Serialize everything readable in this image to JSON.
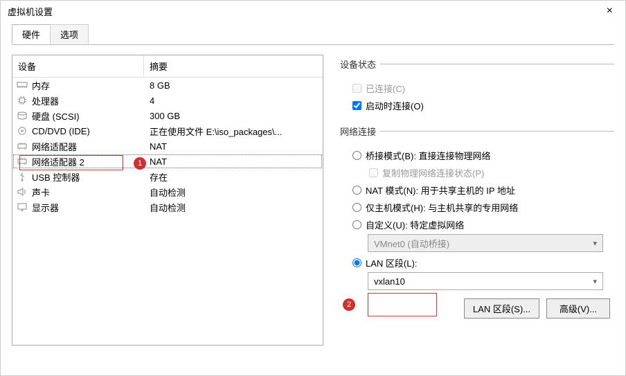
{
  "window": {
    "title": "虚拟机设置",
    "close": "×"
  },
  "tabs": {
    "hardware": "硬件",
    "options": "选项"
  },
  "table": {
    "header_device": "设备",
    "header_summary": "摘要",
    "rows": [
      {
        "icon": "memory-icon",
        "name": "内存",
        "summary": "8 GB"
      },
      {
        "icon": "cpu-icon",
        "name": "处理器",
        "summary": "4"
      },
      {
        "icon": "disk-icon",
        "name": "硬盘 (SCSI)",
        "summary": "300 GB"
      },
      {
        "icon": "cd-icon",
        "name": "CD/DVD (IDE)",
        "summary": "正在使用文件 E:\\iso_packages\\..."
      },
      {
        "icon": "net-icon",
        "name": "网络适配器",
        "summary": "NAT"
      },
      {
        "icon": "net-icon",
        "name": "网络适配器 2",
        "summary": "NAT"
      },
      {
        "icon": "usb-icon",
        "name": "USB 控制器",
        "summary": "存在"
      },
      {
        "icon": "sound-icon",
        "name": "声卡",
        "summary": "自动检测"
      },
      {
        "icon": "display-icon",
        "name": "显示器",
        "summary": "自动检测"
      }
    ]
  },
  "badges": {
    "one": "1",
    "two": "2"
  },
  "device_state": {
    "legend": "设备状态",
    "connected": "已连接(C)",
    "connect_at_power_on": "启动时连接(O)"
  },
  "net": {
    "legend": "网络连接",
    "bridged": "桥接模式(B): 直接连接物理网络",
    "replicate": "复制物理网络连接状态(P)",
    "nat": "NAT 模式(N): 用于共享主机的 IP 地址",
    "hostonly": "仅主机模式(H): 与主机共享的专用网络",
    "custom": "自定义(U): 特定虚拟网络",
    "custom_value": "VMnet0 (自动桥接)",
    "lansegment": "LAN 区段(L):",
    "lansegment_value": "vxlan10"
  },
  "buttons": {
    "lan": "LAN 区段(S)...",
    "adv": "高级(V)..."
  }
}
